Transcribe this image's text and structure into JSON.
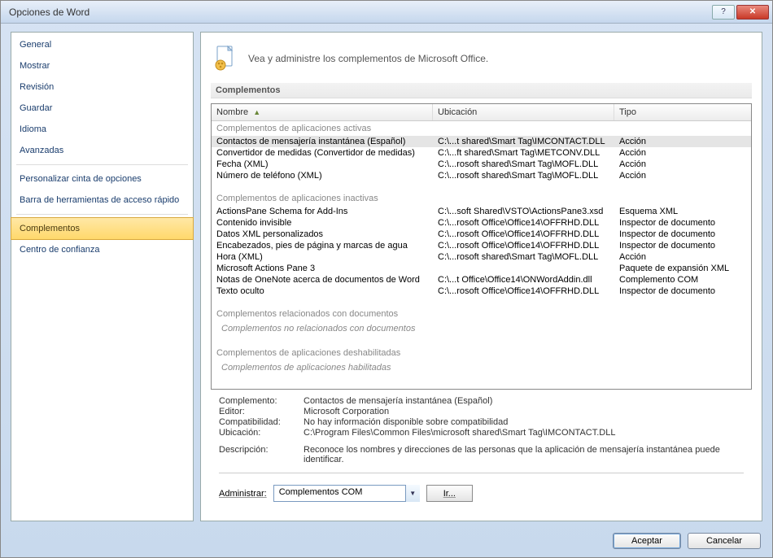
{
  "title": "Opciones de Word",
  "sidebar": {
    "items": [
      {
        "label": "General"
      },
      {
        "label": "Mostrar"
      },
      {
        "label": "Revisión"
      },
      {
        "label": "Guardar"
      },
      {
        "label": "Idioma"
      },
      {
        "label": "Avanzadas"
      }
    ],
    "items2": [
      {
        "label": "Personalizar cinta de opciones"
      },
      {
        "label": "Barra de herramientas de acceso rápido"
      }
    ],
    "items3": [
      {
        "label": "Complementos",
        "selected": true
      },
      {
        "label": "Centro de confianza"
      }
    ]
  },
  "header": {
    "text": "Vea y administre los complementos de Microsoft Office."
  },
  "section_title": "Complementos",
  "table": {
    "headers": {
      "name": "Nombre",
      "location": "Ubicación",
      "type": "Tipo"
    },
    "groups": [
      {
        "title": "Complementos de aplicaciones activas",
        "rows": [
          {
            "name": "Contactos de mensajería instantánea (Español)",
            "loc": "C:\\...t shared\\Smart Tag\\IMCONTACT.DLL",
            "type": "Acción",
            "selected": true
          },
          {
            "name": "Convertidor de medidas (Convertidor de medidas)",
            "loc": "C:\\...ft shared\\Smart Tag\\METCONV.DLL",
            "type": "Acción"
          },
          {
            "name": "Fecha (XML)",
            "loc": "C:\\...rosoft shared\\Smart Tag\\MOFL.DLL",
            "type": "Acción"
          },
          {
            "name": "Número de teléfono (XML)",
            "loc": "C:\\...rosoft shared\\Smart Tag\\MOFL.DLL",
            "type": "Acción"
          }
        ]
      },
      {
        "title": "Complementos de aplicaciones inactivas",
        "rows": [
          {
            "name": "ActionsPane Schema for Add-Ins",
            "loc": "C:\\...soft Shared\\VSTO\\ActionsPane3.xsd",
            "type": "Esquema XML"
          },
          {
            "name": "Contenido invisible",
            "loc": "C:\\...rosoft Office\\Office14\\OFFRHD.DLL",
            "type": "Inspector de documento"
          },
          {
            "name": "Datos XML personalizados",
            "loc": "C:\\...rosoft Office\\Office14\\OFFRHD.DLL",
            "type": "Inspector de documento"
          },
          {
            "name": "Encabezados, pies de página y marcas de agua",
            "loc": "C:\\...rosoft Office\\Office14\\OFFRHD.DLL",
            "type": "Inspector de documento"
          },
          {
            "name": "Hora (XML)",
            "loc": "C:\\...rosoft shared\\Smart Tag\\MOFL.DLL",
            "type": "Acción"
          },
          {
            "name": "Microsoft Actions Pane 3",
            "loc": "",
            "type": "Paquete de expansión XML"
          },
          {
            "name": "Notas de OneNote acerca de documentos de Word",
            "loc": "C:\\...t Office\\Office14\\ONWordAddin.dll",
            "type": "Complemento COM"
          },
          {
            "name": "Texto oculto",
            "loc": "C:\\...rosoft Office\\Office14\\OFFRHD.DLL",
            "type": "Inspector de documento"
          }
        ]
      },
      {
        "title": "Complementos relacionados con documentos",
        "subtitle": "Complementos no relacionados con documentos",
        "rows": []
      },
      {
        "title": "Complementos de aplicaciones deshabilitadas",
        "subtitle": "Complementos de aplicaciones habilitadas",
        "rows": []
      }
    ]
  },
  "details": {
    "rows": [
      {
        "label": "Complemento:",
        "value": "Contactos de mensajería instantánea (Español)"
      },
      {
        "label": "Editor:",
        "value": "Microsoft Corporation"
      },
      {
        "label": "Compatibilidad:",
        "value": "No hay información disponible sobre compatibilidad"
      },
      {
        "label": "Ubicación:",
        "value": "C:\\Program Files\\Common Files\\microsoft shared\\Smart Tag\\IMCONTACT.DLL"
      }
    ],
    "description_label": "Descripción:",
    "description_value": "Reconoce los nombres y direcciones de las personas que la aplicación de mensajería instantánea puede identificar."
  },
  "admin": {
    "label": "Administrar:",
    "selected": "Complementos COM",
    "go": "Ir..."
  },
  "footer": {
    "accept": "Aceptar",
    "cancel": "Cancelar"
  }
}
